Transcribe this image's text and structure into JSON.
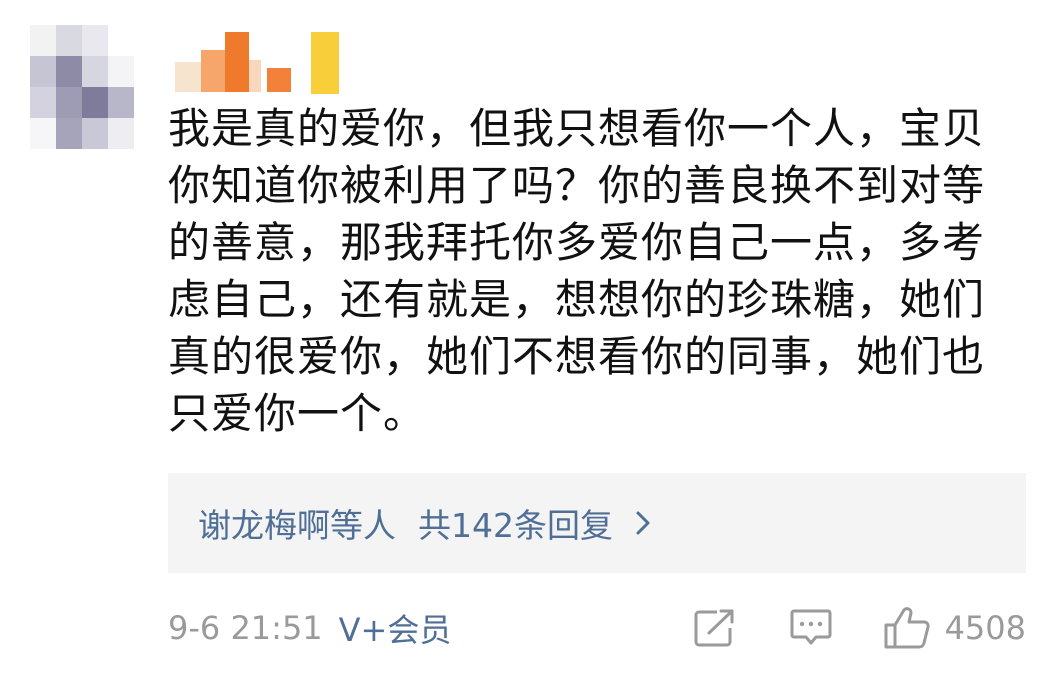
{
  "comment": {
    "lines": [
      "我是真的爱你，但我只想看你一个人，宝贝",
      "你知道你被利用了吗？你的善良换不到对等",
      "的善意，那我拜托你多爱你自己一点，多考",
      "虑自己，还有就是，想想你的珍珠糖，她们",
      "真的很爱你，她们不想看你的同事，她们也",
      "只爱你一个。"
    ]
  },
  "replies": {
    "names": "谢龙梅啊",
    "names_suffix": "等人",
    "count_text": "共142条回复"
  },
  "meta": {
    "timestamp": "9-6 21:51",
    "vip_label": "V+会员"
  },
  "actions": {
    "like_count": "4508"
  },
  "icons": {
    "share": "share-icon",
    "reply": "comment-icon",
    "like": "thumbs-up-icon",
    "chevron": "chevron-right-icon"
  },
  "colors": {
    "link_blue": "#4f6f96",
    "meta_gray": "#9a9a9a",
    "reply_bg": "#f4f4f4",
    "text": "#111111"
  }
}
